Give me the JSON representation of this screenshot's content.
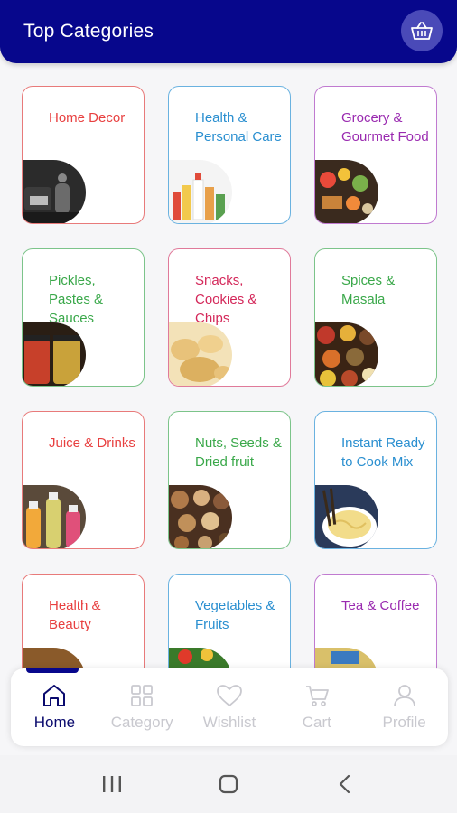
{
  "header": {
    "title": "Top Categories"
  },
  "colors": {
    "header_bg": "#07078c",
    "red": "#e84040",
    "blue": "#2a8fd0",
    "purple": "#9a2ab0",
    "green": "#3aa84a",
    "crimson": "#d4285a"
  },
  "categories": [
    {
      "label": "Home Decor",
      "color": "#e84040"
    },
    {
      "label": "Health & Personal Care",
      "color": "#2a8fd0"
    },
    {
      "label": "Grocery & Gourmet Food",
      "color": "#9a2ab0"
    },
    {
      "label": "Pickles, Pastes & Sauces",
      "color": "#3aa84a"
    },
    {
      "label": "Snacks, Cookies & Chips",
      "color": "#d4285a"
    },
    {
      "label": "Spices & Masala",
      "color": "#3aa84a"
    },
    {
      "label": "Juice & Drinks",
      "color": "#e84040"
    },
    {
      "label": "Nuts, Seeds & Dried fruit",
      "color": "#3aa84a"
    },
    {
      "label": "Instant Ready to Cook Mix",
      "color": "#2a8fd0"
    },
    {
      "label": "Health & Beauty",
      "color": "#e84040"
    },
    {
      "label": "Vegetables & Fruits",
      "color": "#2a8fd0"
    },
    {
      "label": "Tea & Coffee",
      "color": "#9a2ab0"
    }
  ],
  "nav": [
    {
      "label": "Home",
      "icon": "home-icon",
      "active": true
    },
    {
      "label": "Category",
      "icon": "grid-icon",
      "active": false
    },
    {
      "label": "Wishlist",
      "icon": "heart-icon",
      "active": false
    },
    {
      "label": "Cart",
      "icon": "cart-icon",
      "active": false
    },
    {
      "label": "Profile",
      "icon": "user-icon",
      "active": false
    }
  ]
}
